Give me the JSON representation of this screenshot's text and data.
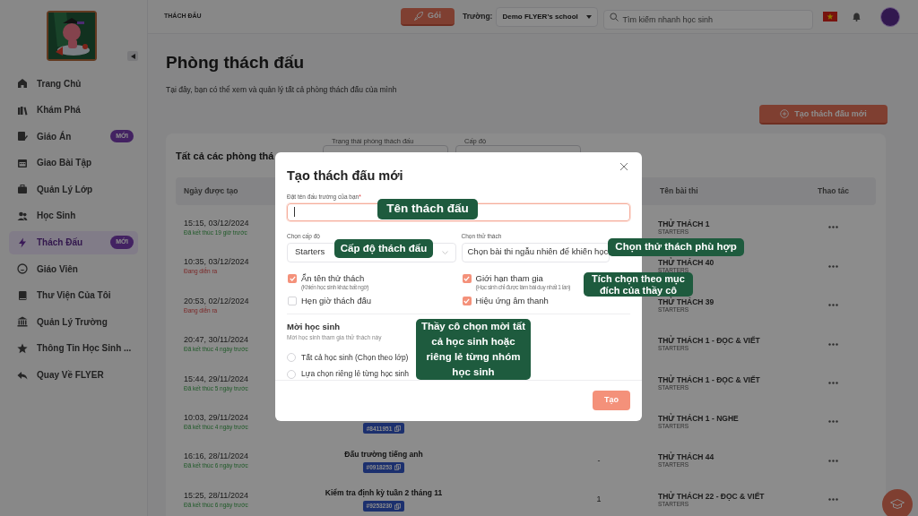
{
  "sidebar": {
    "items": [
      {
        "label": "Trang Chủ",
        "selected": false
      },
      {
        "label": "Khám Phá",
        "selected": false
      },
      {
        "label": "Giáo Án",
        "selected": false,
        "badge": "MỚI"
      },
      {
        "label": "Giao Bài Tập",
        "selected": false
      },
      {
        "label": "Quản Lý Lớp",
        "selected": false
      },
      {
        "label": "Học Sinh",
        "selected": false
      },
      {
        "label": "Thách Đấu",
        "selected": true,
        "badge": "MỚI"
      },
      {
        "label": "Giáo Viên",
        "selected": false
      },
      {
        "label": "Thư Viện Của Tôi",
        "selected": false
      },
      {
        "label": "Quản Lý Trường",
        "selected": false
      },
      {
        "label": "Thông Tin Học Sinh ...",
        "selected": false
      },
      {
        "label": "Quay Về FLYER",
        "selected": false
      }
    ]
  },
  "top_bar": {
    "breadcrumb": "THÁCH ĐẤU",
    "package_button": "Gói",
    "school_label": "Trường:",
    "school": "Demo FLYER's school",
    "search_placeholder": "Tìm kiếm nhanh học sinh"
  },
  "page": {
    "title": "Phòng thách đấu",
    "description": "Tại đây, bạn có thể xem và quản lý tất cả phòng thách đấu của mình",
    "create_button": "Tạo thách đấu mới"
  },
  "card": {
    "title": "Tất cả các phòng thá",
    "filters": [
      {
        "label": "Trạng thái phòng thách đấu"
      },
      {
        "label": "Cấp độ"
      }
    ],
    "table": {
      "columns": [
        "Ngày được tạo",
        "Tên bài thi",
        "Thao tác"
      ],
      "rows": [
        {
          "created": "15:15, 03/12/2024",
          "status": "Đã kết thúc 19 giờ trước",
          "live": false,
          "exam": "THỬ THÁCH 1",
          "level": "STARTERS"
        },
        {
          "created": "10:35, 03/12/2024",
          "status": "Đang diễn ra",
          "live": true,
          "exam": "THỬ THÁCH 40",
          "level": "STARTERS"
        },
        {
          "created": "20:53, 02/12/2024",
          "status": "Đang diễn ra",
          "live": true,
          "exam": "THỬ THÁCH 39",
          "level": "STARTERS"
        },
        {
          "created": "20:47, 30/11/2024",
          "status": "Đã kết thúc 4 ngày trước",
          "live": false,
          "exam": "THỬ THÁCH 1 - ĐỌC & VIẾT",
          "level": "STARTERS"
        },
        {
          "created": "15:44, 29/11/2024",
          "status": "Đã kết thúc 5 ngày trước",
          "live": false,
          "exam": "THỬ THÁCH 1 - ĐỌC & VIẾT",
          "level": "STARTERS"
        },
        {
          "created": "10:03, 29/11/2024",
          "status": "Đã kết thúc 4 ngày trước",
          "live": false,
          "code": "#8411951",
          "exam": "THỬ THÁCH 1 - NGHE",
          "level": "STARTERS"
        },
        {
          "created": "16:16, 28/11/2024",
          "status": "Đã kết thúc 6 ngày trước",
          "live": false,
          "room": "Đấu trường tiếng anh",
          "code": "#0918253",
          "count": "-",
          "exam": "THỬ THÁCH 44",
          "level": "STARTERS"
        },
        {
          "created": "15:25, 28/11/2024",
          "status": "Đã kết thúc 6 ngày trước",
          "live": false,
          "room": "Kiểm tra định kỳ tuần 2 tháng 11",
          "code": "#9253230",
          "count": "1",
          "exam": "THỬ THÁCH 22 - ĐỌC & VIẾT",
          "level": "STARTERS"
        }
      ]
    }
  },
  "modal": {
    "title": "Tạo thách đấu mới",
    "name_field": {
      "label": "Đặt tên đấu trường của bạn",
      "required_mark": "*",
      "focused": true
    },
    "level_field": {
      "label": "Chọn cấp độ",
      "value": "Starters"
    },
    "challenge_field": {
      "label": "Chọn thử thách",
      "value": "Chọn bài thi ngẫu nhiên để khiến học"
    },
    "options": [
      {
        "label": "Ẩn tên thử thách",
        "hint": "(Khiến học sinh khác bất ngờ)",
        "checked": true
      },
      {
        "label": "Giới hạn tham gia",
        "hint": "(Học sinh chỉ được làm bài duy nhất 1 lần)",
        "checked": true
      },
      {
        "label": "Hẹn giờ thách đấu",
        "checked": false
      },
      {
        "label": "Hiệu ứng âm thanh",
        "checked": true
      }
    ],
    "invite": {
      "title": "Mời học sinh",
      "subtitle": "Mời học sinh tham gia thử thách này",
      "choices": [
        {
          "label": "Tất cả học sinh (Chọn theo lớp)",
          "selected": false
        },
        {
          "label": "Lựa chọn riêng lẻ từng học sinh",
          "selected": false
        }
      ]
    },
    "submit": "Tạo"
  },
  "annotations": [
    "Tên thách đấu",
    "Cấp độ thách đấu",
    "Chọn thử thách phù hợp",
    "Tích chọn theo mục đích của thầy cô",
    "Thầy cô chọn mời tất cả học sinh hoặc riêng lẻ từng nhóm học sinh"
  ]
}
